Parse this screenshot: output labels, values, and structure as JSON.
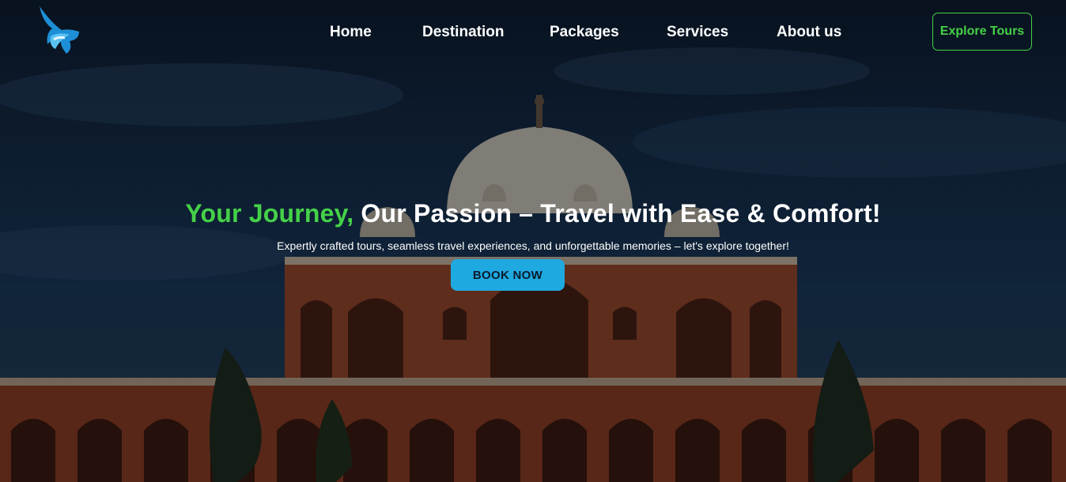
{
  "nav": {
    "logo": "bird-logo",
    "items": [
      {
        "label": "Home"
      },
      {
        "label": "Destination"
      },
      {
        "label": "Packages"
      },
      {
        "label": "Services"
      },
      {
        "label": "About us"
      }
    ],
    "cta_label": "Explore Tours"
  },
  "hero": {
    "headline_accent": "Your Journey,",
    "headline_rest": " Our Passion – Travel with Ease & Comfort!",
    "subtitle": "Expertly crafted tours, seamless travel experiences, and unforgettable memories – let's explore together!",
    "button_label": "BOOK NOW",
    "background_image": "monument-photo"
  },
  "colors": {
    "accent_green": "#45d148",
    "button_blue": "#1fa9e1"
  }
}
